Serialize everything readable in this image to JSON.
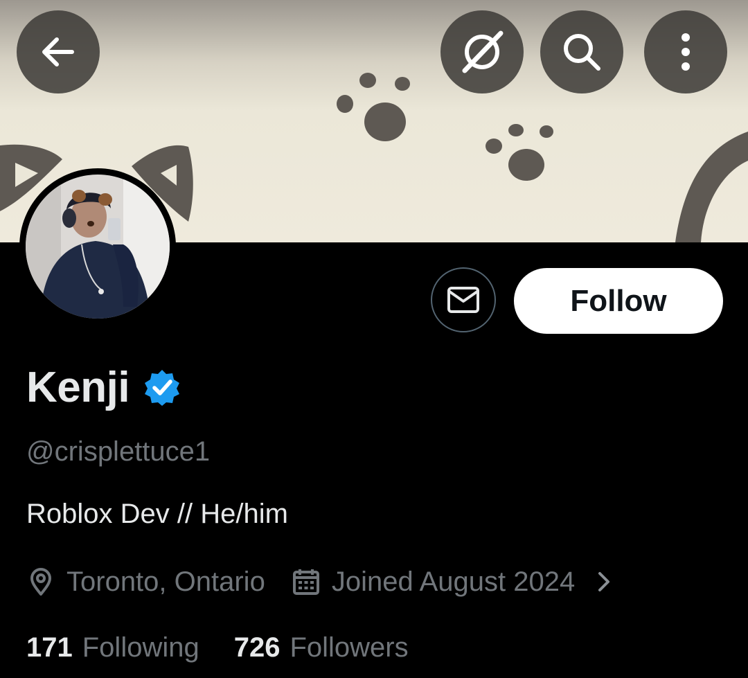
{
  "header": {
    "back_icon": "arrow-left-icon",
    "grok_icon": "grok-icon",
    "search_icon": "search-icon",
    "more_icon": "more-vertical-icon"
  },
  "profile": {
    "name": "Kenji",
    "verified": true,
    "handle": "@crisplettuce1",
    "bio": "Roblox Dev // He/him",
    "location": "Toronto, Ontario",
    "joined": "Joined August 2024",
    "following_count": "171",
    "following_label": "Following",
    "followers_count": "726",
    "followers_label": "Followers"
  },
  "actions": {
    "message_icon": "mail-icon",
    "follow_label": "Follow"
  },
  "colors": {
    "background": "#000000",
    "verified_badge": "#1d9bf0",
    "muted_text": "#71767b",
    "follow_button_bg": "#ffffff"
  }
}
